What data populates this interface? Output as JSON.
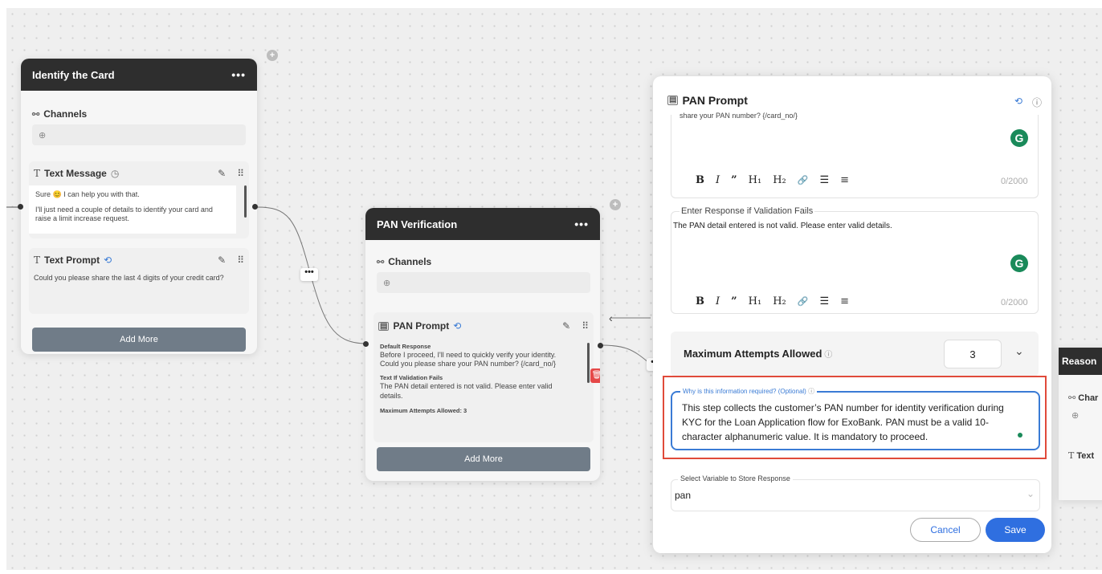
{
  "node1": {
    "title": "Identify the Card",
    "menu": "•••",
    "channels_label": "Channels",
    "text_message": {
      "label": "Text Message",
      "line1": "Sure 😊 I can help you with that.",
      "line2": "I'll just need a couple of details to identify your card and raise a limit increase request."
    },
    "text_prompt": {
      "label": "Text Prompt",
      "body": "Could you please share the last 4 digits of your credit card?"
    },
    "add_more": "Add More"
  },
  "node2": {
    "title": "PAN Verification",
    "menu": "•••",
    "channels_label": "Channels",
    "pan_prompt": {
      "label": "PAN Prompt",
      "default_response_label": "Default Response",
      "default_response": "Before I proceed, I'll need to quickly verify your identity. Could you please share your PAN number? {/card_no/}",
      "validation_label": "Text If Validation Fails",
      "validation_text": "The PAN detail entered is not valid. Please enter valid details.",
      "max_attempts": "Maximum Attempts Allowed: 3"
    },
    "add_more": "Add More"
  },
  "connector_menu": "•••",
  "panel": {
    "title": "PAN Prompt",
    "top_editor_partial": "share your PAN number? {/card_no/}",
    "toolbar": [
      "B",
      "I",
      "”",
      "H₁",
      "H₂",
      "🔗",
      "☰",
      "≡"
    ],
    "counter": "0/2000",
    "grammarly": "G",
    "validation_editor": {
      "label": "Enter Response if Validation Fails",
      "value": "The PAN detail entered is not valid. Please enter valid details."
    },
    "max_attempts": {
      "label": "Maximum Attempts Allowed",
      "value": "3"
    },
    "why_required": {
      "label": "Why is this information required? (Optional)",
      "value": "This step collects the customer’s PAN number for identity verification during KYC for the Loan Application flow for ExoBank. PAN must be a valid 10-character alphanumeric value. It is mandatory to proceed."
    },
    "select_variable": {
      "label": "Select Variable to Store Response",
      "value": "pan"
    },
    "cancel": "Cancel",
    "save": "Save"
  },
  "fragment_node": {
    "title": "Reason",
    "channels_partial": "Char",
    "text_partial": "Text"
  },
  "colors": {
    "header_bg": "#2e2e2e",
    "add_more_bg": "#707c88",
    "save_bg": "#2f6fe0",
    "highlight_border": "#e04a3a",
    "focus_border": "#3a7bd5",
    "grammarly": "#1a8a5a"
  }
}
